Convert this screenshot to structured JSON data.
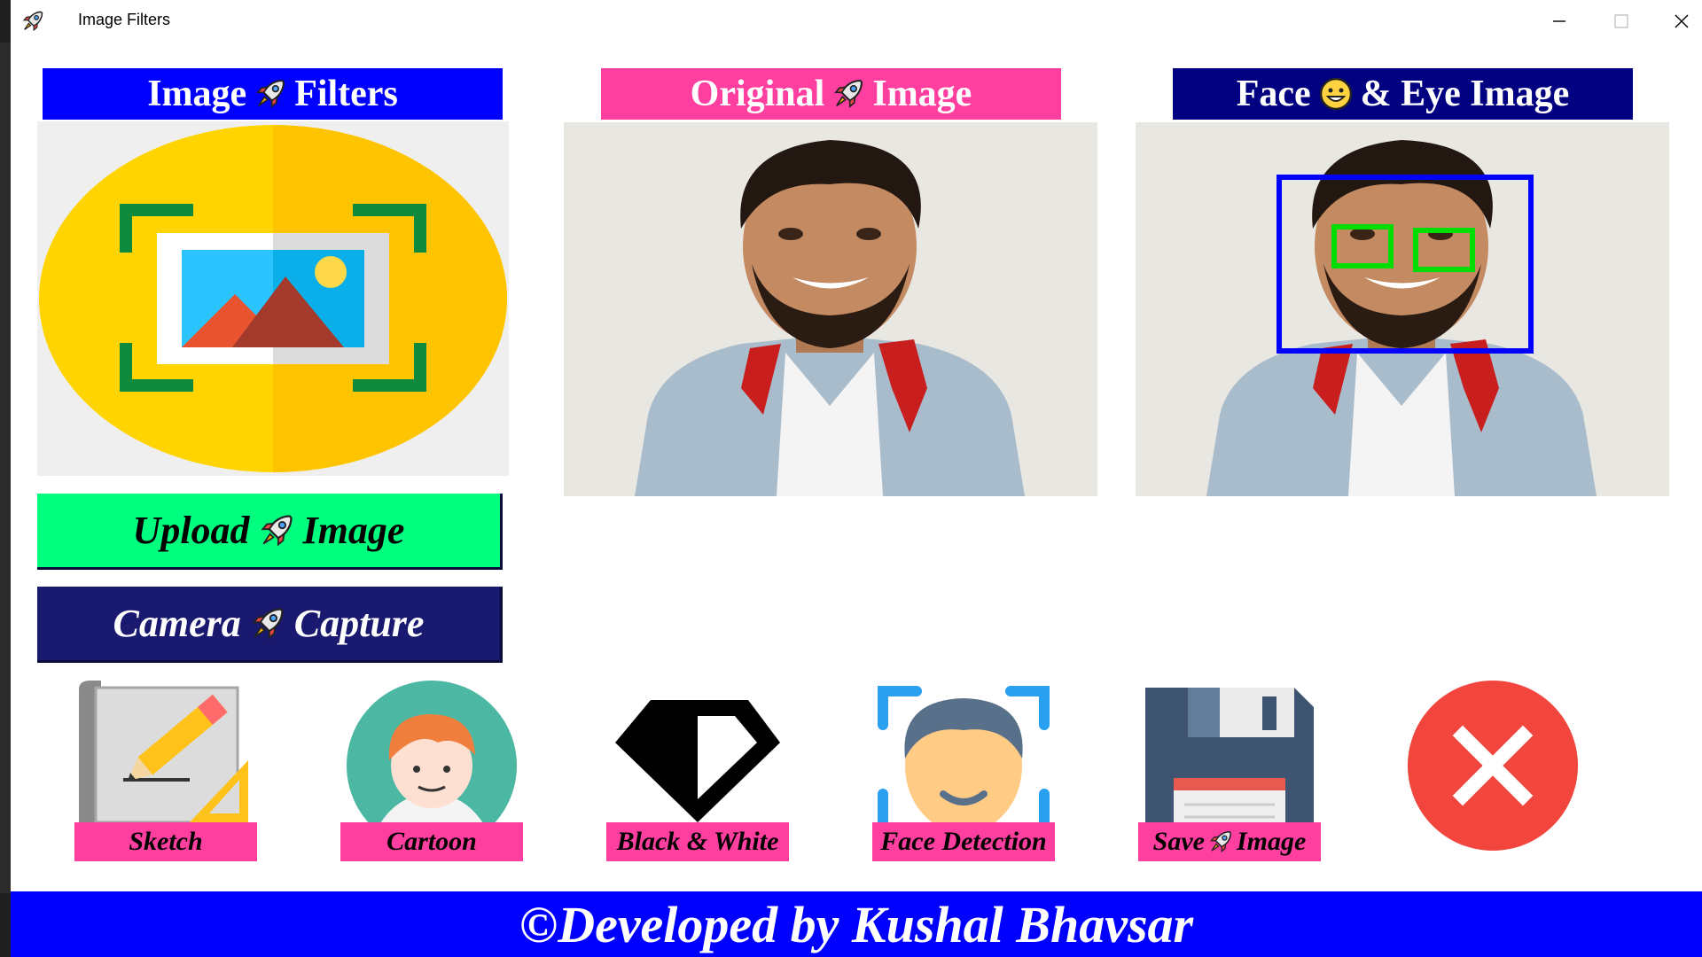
{
  "window": {
    "title": "Image Filters",
    "icon": "rocket-icon",
    "controls": [
      "minimize-icon",
      "maximize-icon",
      "close-icon"
    ]
  },
  "headers": {
    "filters": {
      "before": "Image",
      "icon": "rocket-icon",
      "after": "Filters",
      "bg": "#0000ff"
    },
    "original": {
      "before": "Original",
      "icon": "rocket-icon",
      "after": "Image",
      "bg": "#ff3fa0"
    },
    "face": {
      "before": "Face",
      "icon": "smiley-face-icon",
      "after": "& Eye Image",
      "bg": "#000080"
    }
  },
  "buttons": {
    "upload": {
      "before": "Upload",
      "icon": "rocket-icon",
      "after": "Image",
      "bg": "#00ff7f"
    },
    "camera": {
      "before": "Camera",
      "icon": "rocket-icon",
      "after": "Capture",
      "bg": "#191970"
    }
  },
  "tools": [
    {
      "id": "sketch",
      "label": "Sketch",
      "icon": "pencil-sketch-icon"
    },
    {
      "id": "cartoon",
      "label": "Cartoon",
      "icon": "cartoon-boy-icon"
    },
    {
      "id": "bw",
      "label": "Black & White",
      "icon": "black-white-diamond-icon"
    },
    {
      "id": "face",
      "label": "Face Detection",
      "icon": "face-detection-icon"
    },
    {
      "id": "save",
      "label_before": "Save",
      "label_after": "Image",
      "icon": "floppy-disk-icon"
    },
    {
      "id": "exit",
      "icon": "exit-x-icon"
    }
  ],
  "footer": {
    "text": "©Developed by Kushal Bhavsar",
    "bg": "#0000ff"
  },
  "colors": {
    "accent_pink": "#ff3fa0",
    "face_box": "#0000ff",
    "eye_box": "#00dd00"
  }
}
